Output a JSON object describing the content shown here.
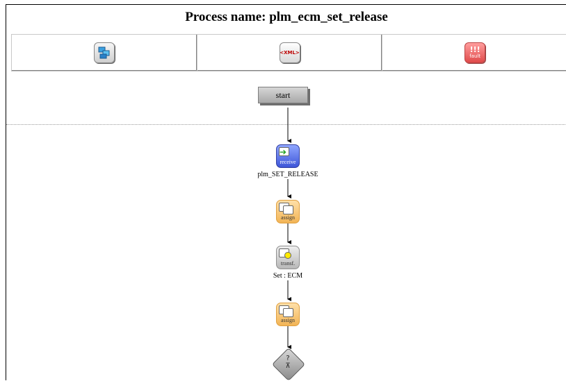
{
  "header": {
    "title": "Process name: plm_ecm_set_release"
  },
  "toolbar": {
    "buttons": [
      {
        "name": "diagram-view",
        "icon": "diagram-icon"
      },
      {
        "name": "xml-view",
        "icon": "xml-icon",
        "text": "<XML>"
      },
      {
        "name": "fault-view",
        "icon": "fault-icon",
        "glyph": "!!!",
        "text": "fault"
      }
    ]
  },
  "flow": {
    "start": {
      "label": "start"
    },
    "nodes": [
      {
        "type": "receive",
        "caption": "receive",
        "label": "plm_SET_RELEASE"
      },
      {
        "type": "assign",
        "caption": "assign",
        "label": ""
      },
      {
        "type": "transform",
        "caption": "transf.",
        "label": "Set : ECM"
      },
      {
        "type": "assign",
        "caption": "assign",
        "label": ""
      },
      {
        "type": "switch",
        "glyph": "?",
        "label": ""
      }
    ]
  },
  "colors": {
    "receive": "#5a70e8",
    "assign": "#f5c070",
    "transform": "#c8c8c8",
    "fault": "#f06868",
    "connector": "#000000"
  }
}
